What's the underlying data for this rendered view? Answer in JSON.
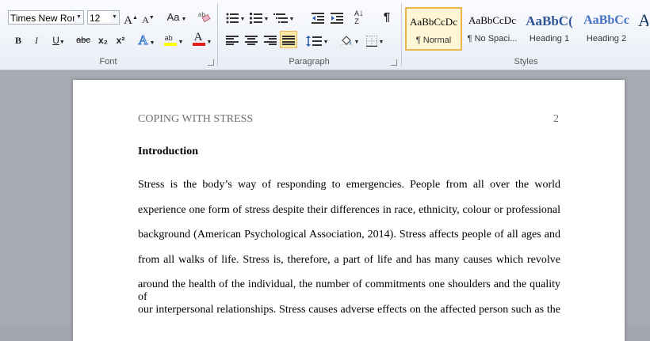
{
  "ribbon": {
    "font": {
      "label": "Font",
      "font_name": "Times New Rom",
      "font_size": "12",
      "grow_label": "A",
      "shrink_label": "A",
      "case_label": "Aa",
      "bold": "B",
      "italic": "I",
      "underline": "U",
      "strike": "abc",
      "subscript": "x₂",
      "superscript": "x²",
      "highlight_label": "ab",
      "font_color_label": "A",
      "clear_label": "ab"
    },
    "paragraph": {
      "label": "Paragraph",
      "sort_label": "A↓Z",
      "pilcrow": "¶"
    },
    "styles": {
      "label": "Styles",
      "items": [
        {
          "sample": "AaBbCcDc",
          "name": "¶ Normal"
        },
        {
          "sample": "AaBbCcDc",
          "name": "¶ No Spaci..."
        },
        {
          "sample": "AaBbC(",
          "name": "Heading 1"
        },
        {
          "sample": "AaBbCc",
          "name": "Heading 2"
        }
      ],
      "overflow_sample": "A"
    },
    "colors": {
      "highlight": "#ffff00",
      "font_color": "#e3211c",
      "selected_style": "#e8b64c"
    }
  },
  "document": {
    "header_title": "COPING WITH STRESS",
    "page_number": "2",
    "heading": "Introduction",
    "lines": [
      "Stress is the body’s way of responding to emergencies. People from all over the world",
      "experience one form of stress despite their differences in race, ethnicity, colour or professional",
      "background (American Psychological Association, 2014). Stress affects people of all ages and",
      "from all walks of life. Stress is, therefore, a part of life and has many causes which revolve",
      "around the health of the individual, the number of commitments one shoulders and the quality of",
      "our interpersonal relationships.  Stress causes adverse effects on the affected person such as the"
    ]
  }
}
